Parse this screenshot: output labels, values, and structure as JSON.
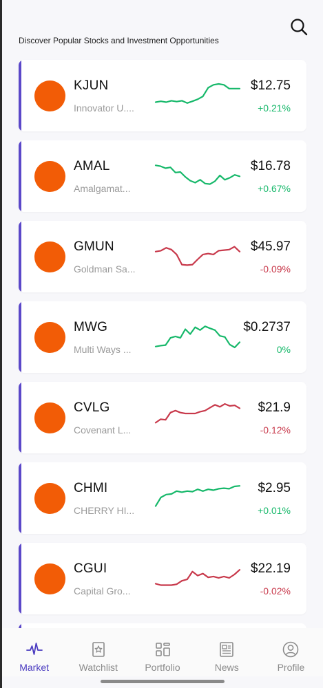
{
  "header": {
    "subtitle": "Discover Popular Stocks and Investment Opportunities",
    "search_icon": "search-icon"
  },
  "colors": {
    "accent": "#5b48c9",
    "logo": "#f25c06",
    "up": "#16b86a",
    "down": "#c8394b",
    "active_tab": "#4b3cc0"
  },
  "stocks": [
    {
      "ticker": "KJUN",
      "company": "Innovator U....",
      "price": "$12.75",
      "change": "+0.21%",
      "trend": "up",
      "spark": [
        0.25,
        0.28,
        0.25,
        0.3,
        0.27,
        0.3,
        0.22,
        0.28,
        0.35,
        0.45,
        0.75,
        0.85,
        0.88,
        0.85,
        0.72,
        0.72,
        0.72
      ]
    },
    {
      "ticker": "AMAL",
      "company": "Amalgamat...",
      "price": "$16.78",
      "change": "+0.67%",
      "trend": "up",
      "spark": [
        0.85,
        0.82,
        0.75,
        0.78,
        0.6,
        0.62,
        0.45,
        0.32,
        0.25,
        0.35,
        0.22,
        0.2,
        0.3,
        0.5,
        0.35,
        0.42,
        0.52,
        0.47
      ]
    },
    {
      "ticker": "GMUN",
      "company": "Goldman Sa...",
      "price": "$45.97",
      "change": "-0.09%",
      "trend": "down",
      "spark": [
        0.65,
        0.68,
        0.78,
        0.72,
        0.55,
        0.2,
        0.18,
        0.2,
        0.38,
        0.55,
        0.58,
        0.55,
        0.68,
        0.7,
        0.72,
        0.82,
        0.65
      ]
    },
    {
      "ticker": "MWG",
      "company": "Multi Ways ...",
      "price": "$0.2737",
      "change": "0%",
      "trend": "flat",
      "spark": [
        0.15,
        0.18,
        0.2,
        0.45,
        0.5,
        0.45,
        0.75,
        0.58,
        0.82,
        0.72,
        0.85,
        0.78,
        0.72,
        0.52,
        0.48,
        0.22,
        0.12,
        0.3
      ]
    },
    {
      "ticker": "CVLG",
      "company": "Covenant L...",
      "price": "$21.9",
      "change": "-0.12%",
      "trend": "down",
      "spark": [
        0.3,
        0.42,
        0.4,
        0.65,
        0.72,
        0.65,
        0.62,
        0.62,
        0.62,
        0.68,
        0.72,
        0.82,
        0.92,
        0.85,
        0.95,
        0.88,
        0.9,
        0.8
      ]
    },
    {
      "ticker": "CHMI",
      "company": "CHERRY HI...",
      "price": "$2.95",
      "change": "+0.01%",
      "trend": "up",
      "spark": [
        0.2,
        0.5,
        0.6,
        0.62,
        0.72,
        0.68,
        0.72,
        0.7,
        0.78,
        0.72,
        0.78,
        0.75,
        0.8,
        0.82,
        0.8,
        0.88,
        0.9
      ]
    },
    {
      "ticker": "CGUI",
      "company": "Capital Gro...",
      "price": "$22.19",
      "change": "-0.02%",
      "trend": "down",
      "spark": [
        0.3,
        0.25,
        0.25,
        0.25,
        0.28,
        0.4,
        0.45,
        0.72,
        0.58,
        0.65,
        0.52,
        0.55,
        0.5,
        0.55,
        0.5,
        0.62,
        0.78
      ]
    }
  ],
  "tabs": [
    {
      "label": "Market",
      "icon": "pulse-icon",
      "active": true
    },
    {
      "label": "Watchlist",
      "icon": "star-bookmark-icon",
      "active": false
    },
    {
      "label": "Portfolio",
      "icon": "grid-icon",
      "active": false
    },
    {
      "label": "News",
      "icon": "newspaper-icon",
      "active": false
    },
    {
      "label": "Profile",
      "icon": "user-icon",
      "active": false
    }
  ]
}
